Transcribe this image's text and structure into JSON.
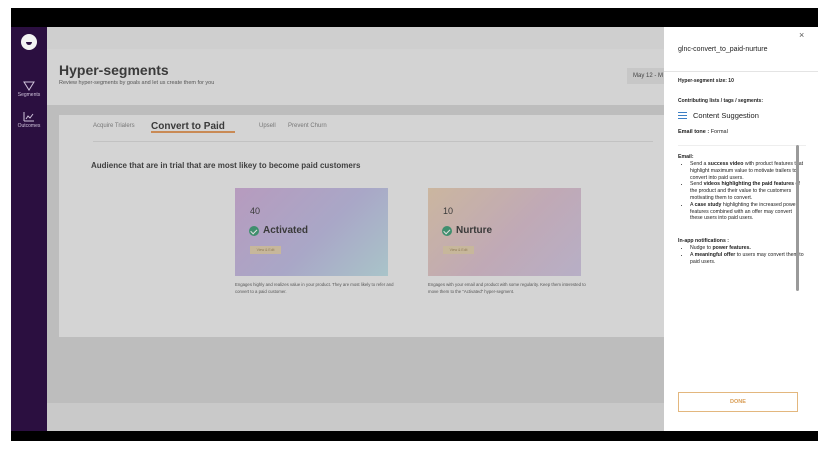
{
  "nav": {
    "items": [
      {
        "label": "Segments",
        "icon": "funnel-icon"
      },
      {
        "label": "Outcomes",
        "icon": "chart-icon"
      }
    ]
  },
  "header": {
    "title": "Hyper-segments",
    "subtitle": "Review hyper-segments by goals and let us create them for you",
    "date_range": "May 12 - M"
  },
  "tabs": [
    {
      "label": "Acquire Trialers"
    },
    {
      "label": "Convert to Paid"
    },
    {
      "label": "Upsell"
    },
    {
      "label": "Prevent Churn"
    }
  ],
  "section_title": "Audience that are in trial that are most likey to become paid customers",
  "segments": [
    {
      "count": "40",
      "name": "Activated",
      "button": "View & Edit",
      "description": "Engages highly and realizes value in your product. They are most likely to refer and convert to a paid customer."
    },
    {
      "count": "10",
      "name": "Nurture",
      "button": "View & Edit",
      "description": "Engages with your email and product with some regularity. Keep them interested to move them to the \"Activated\" hyper-segment."
    }
  ],
  "panel": {
    "title": "glnc-convert_to_paid-nurture",
    "close": "×",
    "size_label": "Hyper-segment size: 10",
    "contrib_label": "Contributing lists / tags / segments:",
    "contrib_item": "Content Suggestion",
    "tone_label": "Email tone :",
    "tone_value": " Formal",
    "email_heading": "Email:",
    "email_items": [
      {
        "pre": "Send a ",
        "bold": "success video",
        "post": " with product features that highlight maximum value to motivate trailers to convert into paid users."
      },
      {
        "pre": "Send ",
        "bold": "videos highlighting the paid features",
        "post": " of the product and their value to the customers motivating them to convert."
      },
      {
        "pre": "A ",
        "bold": "case study",
        "post": " highlighting the increased power features combined with an offer may convert these users into paid users."
      }
    ],
    "inapp_heading": "In-app notifications :",
    "inapp_items": [
      {
        "pre": "Nudge to ",
        "bold": "power features.",
        "post": ""
      },
      {
        "pre": "A ",
        "bold": "meaningful offer",
        "post": " to users may convert them to paid users."
      }
    ],
    "done": "DONE"
  }
}
